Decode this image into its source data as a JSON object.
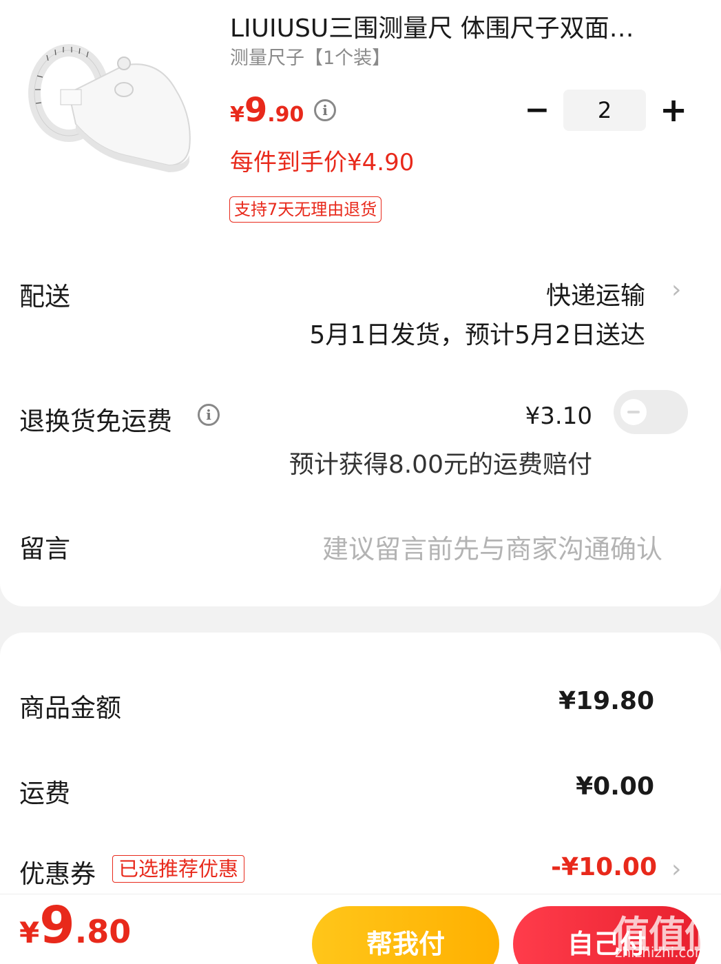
{
  "product": {
    "title": "LIUIUSU三围测量尺 体围尺子双面…",
    "spec": "测量尺子【1个装】",
    "price_currency": "¥",
    "price_int": "9",
    "price_dec": ".90",
    "unit_price_text": "每件到手价¥4.90",
    "return_tag": "支持7天无理由退货",
    "quantity": "2",
    "minus_label": "−",
    "plus_label": "+"
  },
  "delivery": {
    "label": "配送",
    "type": "快递运输",
    "date": "5月1日发货，预计5月2日送达"
  },
  "return_insurance": {
    "label": "退换货免运费",
    "amount": "¥3.10",
    "compensation": "预计获得8.00元的运费赔付",
    "enabled": false
  },
  "message": {
    "label": "留言",
    "placeholder": "建议留言前先与商家沟通确认"
  },
  "summary": {
    "goods_label": "商品金额",
    "goods_value": "¥19.80",
    "shipping_label": "运费",
    "shipping_value": "¥0.00",
    "coupon_label": "优惠券",
    "coupon_tag": "已选推荐优惠",
    "coupon_value": "-¥10.00"
  },
  "footer": {
    "total_currency": "¥",
    "total_int": "9",
    "total_dec": ".80",
    "help_pay": "帮我付",
    "self_pay": "自己付",
    "watermark": "值值值",
    "watermark_sub": "zhizhizhi.com"
  },
  "icons": {
    "chevron": "›",
    "info": "i"
  },
  "colors": {
    "accent_red": "#e8291b",
    "help_yellow": "#ffb800",
    "pay_red": "#f02c3b"
  }
}
